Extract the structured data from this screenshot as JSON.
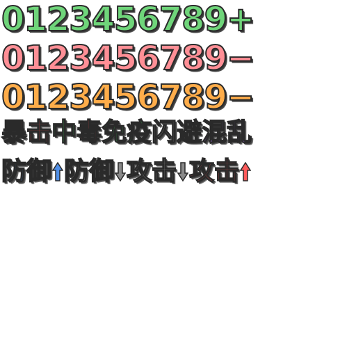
{
  "rows": {
    "green_digits": "0123456789+",
    "red_digits": "0123456789−",
    "orange_digits": "0123456789−"
  },
  "status": {
    "crit": "暴击",
    "hit": "中",
    "poison": "毒",
    "immune": "免疫",
    "dodge": "闪避",
    "confuse": "混乱"
  },
  "buffs": {
    "def_up": "防御",
    "def_down": "防御",
    "atk_down": "攻击",
    "atk_up": "攻击"
  },
  "colors": {
    "green": "#6fd57a",
    "red": "#ff8f96",
    "orange": "#ffad4a",
    "crit": "#ff4a4a",
    "hit": "#39c454",
    "silver": "#d9d9d9",
    "purple": "#a66df0",
    "blue": "#4f8fe8",
    "gray": "#b8b8b8",
    "arrow_up_blue": "#4f8fe8",
    "arrow_down_gray": "#8a8a8a",
    "arrow_up_red": "#ff5b5b"
  },
  "icons": {
    "up_arrow": "arrow-up-icon",
    "down_arrow": "arrow-down-icon"
  }
}
